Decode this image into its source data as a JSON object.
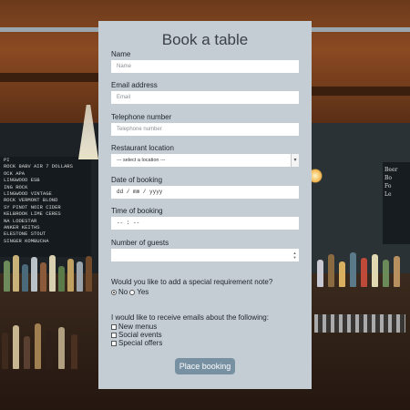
{
  "form": {
    "title": "Book a table",
    "fields": {
      "name": {
        "label": "Name",
        "placeholder": "Name"
      },
      "email": {
        "label": "Email address",
        "placeholder": "Email"
      },
      "phone": {
        "label": "Telephone number",
        "placeholder": "Telephone number"
      },
      "location": {
        "label": "Restaurant location",
        "selected": "--- select a location ---"
      },
      "date": {
        "label": "Date of booking",
        "value": "dd / mm / yyyy"
      },
      "time": {
        "label": "Time of booking",
        "value": "-- : --"
      },
      "guests": {
        "label": "Number of guests",
        "value": ""
      }
    },
    "special_requirement": {
      "question": "Would you like to add a special requirement note?",
      "options": [
        {
          "label": "No",
          "selected": true
        },
        {
          "label": "Yes",
          "selected": false
        }
      ]
    },
    "emails": {
      "question": "I would like to receive emails about the following:",
      "options": [
        {
          "label": "New menus",
          "checked": false
        },
        {
          "label": "Social events",
          "checked": false
        },
        {
          "label": "Special offers",
          "checked": false
        }
      ]
    },
    "submit_label": "Place booking"
  },
  "background": {
    "board_lines": [
      "PI",
      "ROCK 8ABV  AIR 7 DOLLARS",
      "OCK    APA",
      "LINGWOOD  ESB",
      "ING ROCK",
      "LINGWOOD VINTAGE",
      "ROCK VERMONT BLOND",
      "SY PINOT NOIR CIDER",
      "KELBROOK LIME CERES",
      "NA LODESTAR",
      "ANKER KEITHS",
      "ELESTONE STOUT",
      "SINGER KOMBUCHA"
    ],
    "board_right_lines": [
      "Beer",
      "Bo",
      "Fo",
      "Le"
    ]
  }
}
